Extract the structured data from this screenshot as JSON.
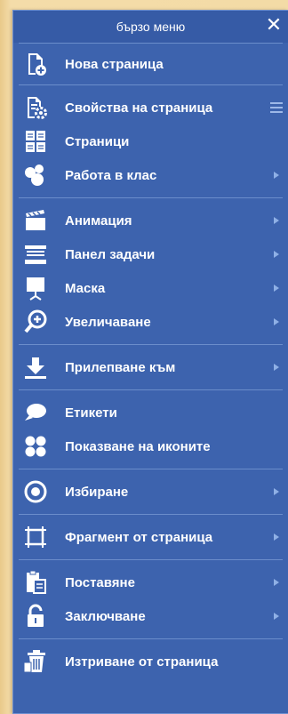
{
  "panel": {
    "title": "бързо меню",
    "close_glyph": "✕"
  },
  "items": [
    {
      "label": "Нова страница",
      "icon": "new-page-icon",
      "submenu": false
    },
    {
      "label": "Свойства на страница",
      "icon": "page-properties-icon",
      "submenu": false,
      "menu": true
    },
    {
      "label": "Страници",
      "icon": "pages-icon",
      "submenu": false
    },
    {
      "label": "Работа в клас",
      "icon": "classwork-icon",
      "submenu": true
    },
    {
      "label": "Анимация",
      "icon": "animation-icon",
      "submenu": true
    },
    {
      "label": "Панел задачи",
      "icon": "task-panel-icon",
      "submenu": true
    },
    {
      "label": "Маска",
      "icon": "mask-icon",
      "submenu": true
    },
    {
      "label": "Увеличаване",
      "icon": "zoom-in-icon",
      "submenu": true
    },
    {
      "label": "Прилепване към",
      "icon": "snap-to-icon",
      "submenu": true
    },
    {
      "label": "Етикети",
      "icon": "labels-icon",
      "submenu": false
    },
    {
      "label": "Показване на иконите",
      "icon": "show-icons-icon",
      "submenu": false
    },
    {
      "label": "Избиране",
      "icon": "select-icon",
      "submenu": true
    },
    {
      "label": "Фрагмент от страница",
      "icon": "page-fragment-icon",
      "submenu": true
    },
    {
      "label": "Поставяне",
      "icon": "paste-icon",
      "submenu": true
    },
    {
      "label": "Заключване",
      "icon": "lock-icon",
      "submenu": true
    },
    {
      "label": "Изтриване от страница",
      "icon": "delete-icon",
      "submenu": false
    }
  ],
  "colors": {
    "panel_bg": "#3d63ae",
    "separator": "#6b8dcb",
    "text": "#ffffff",
    "arrow": "#8fb0e6",
    "background": "#f3dba6"
  }
}
